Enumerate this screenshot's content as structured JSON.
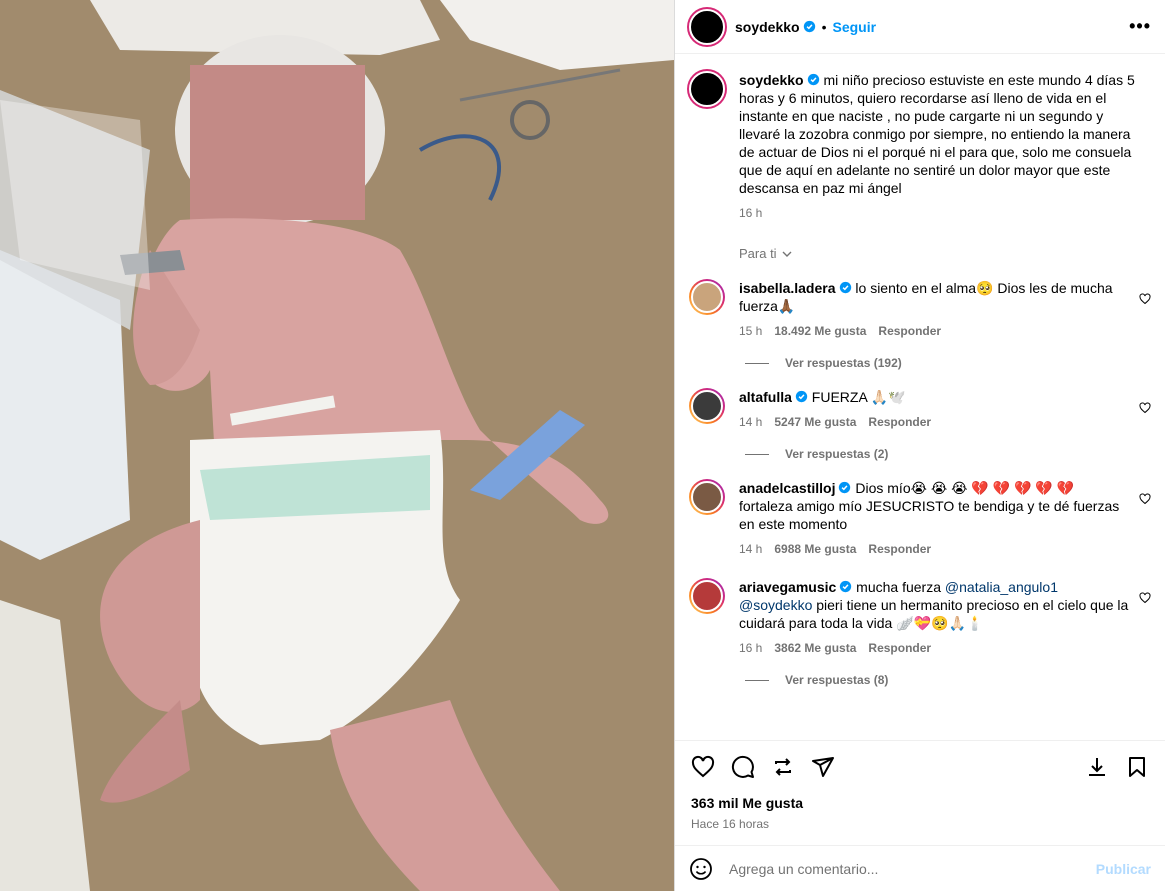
{
  "header": {
    "username": "soydekko",
    "follow_label": "Seguir",
    "separator": "•",
    "more": "•••"
  },
  "caption": {
    "username": "soydekko",
    "text": " mi niño precioso estuviste en este mundo 4 días 5 horas y 6 minutos, quiero recordarse así lleno de vida en el instante en que naciste , no pude cargarte ni un segundo y llevaré la zozobra conmigo por siempre, no entiendo la manera de actuar de Dios ni el porqué ni el para que, solo me consuela que de aquí en adelante no sentiré un dolor mayor que este descansa en paz mi ángel",
    "time": "16 h"
  },
  "filter": {
    "label": "Para ti"
  },
  "comments": [
    {
      "username": "isabella.ladera",
      "text": " lo siento en el alma🥺  Dios les de mucha fuerza🙏🏾",
      "time": "15 h",
      "likes": "18.492 Me gusta",
      "reply": "Responder",
      "replies": "Ver respuestas (192)"
    },
    {
      "username": "altafulla",
      "text": " FUERZA 🙏🏻🕊️",
      "time": "14 h",
      "likes": "5247 Me gusta",
      "reply": "Responder",
      "replies": "Ver respuestas (2)"
    },
    {
      "username": "anadelcastilloj",
      "text": " Dios mío😭 😭 😭 💔 💔 💔 💔 💔 fortaleza amigo mío JESUCRISTO te bendiga y te dé fuerzas en este momento",
      "time": "14 h",
      "likes": "6988 Me gusta",
      "reply": "Responder"
    },
    {
      "username": "ariavegamusic",
      "text_before": " mucha fuerza ",
      "mention1": "@natalia_angulo1",
      "mention2": "@soydekko",
      "text_after": " pieri tiene un hermanito precioso en el cielo que la cuidará para toda la vida 🪽💝🥺🙏🏻🕯️",
      "time": "16 h",
      "likes": "3862 Me gusta",
      "reply": "Responder",
      "replies": "Ver respuestas (8)"
    }
  ],
  "footer": {
    "likes": "363 mil Me gusta",
    "time": "Hace 16 horas"
  },
  "add_comment": {
    "placeholder": "Agrega un comentario...",
    "publish": "Publicar"
  },
  "colors": {
    "link": "#0095f6",
    "muted": "#737373",
    "verified": "#0095f6"
  }
}
